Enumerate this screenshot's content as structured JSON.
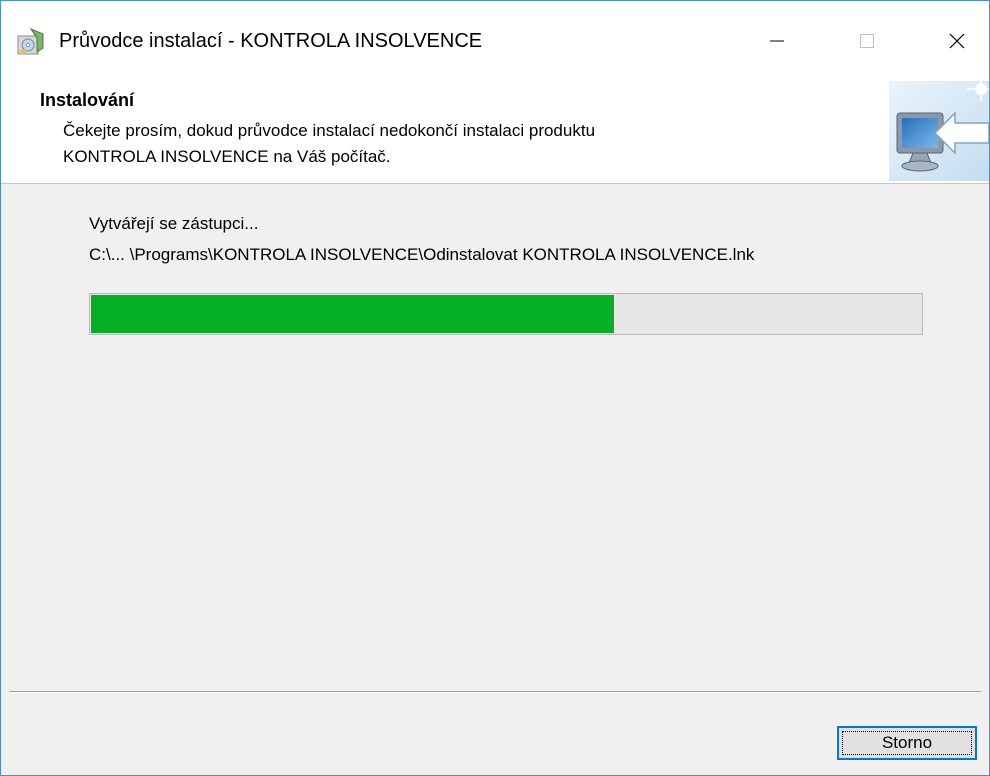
{
  "window": {
    "title": "Průvodce instalací - KONTROLA INSOLVENCE",
    "icon": "installer-disk-icon",
    "controls": [
      "minimize-icon",
      "maximize-icon",
      "close-icon"
    ]
  },
  "header": {
    "title": "Instalování",
    "description_line1": "Čekejte prosím, dokud průvodce instalací nedokončí instalaci produktu",
    "description_line2": "KONTROLA INSOLVENCE na Váš počítač.",
    "image": "computer-install-arrow-icon"
  },
  "status": {
    "action": "Vytvářejí se zástupci...",
    "file": "C:\\... \\Programs\\KONTROLA INSOLVENCE\\Odinstalovat KONTROLA INSOLVENCE.lnk",
    "progress_fraction": 0.63
  },
  "footer": {
    "cancel_label": "Storno"
  },
  "colors": {
    "progress_fill": "#06b025",
    "progress_track": "#e6e6e6",
    "window_border": "#4a8fd4",
    "focus_border": "#0078d7"
  }
}
